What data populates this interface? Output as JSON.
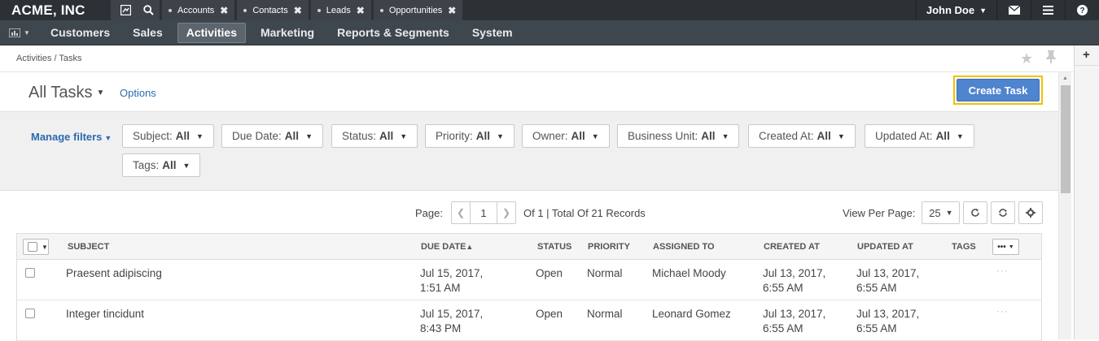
{
  "app": {
    "brand": "ACME, INC"
  },
  "topbar": {
    "quick_tabs": [
      "Accounts",
      "Contacts",
      "Leads",
      "Opportunities"
    ],
    "user_name": "John Doe",
    "icons": [
      "dashboard-icon",
      "search-icon",
      "envelope-icon",
      "menu-icon",
      "help-icon"
    ]
  },
  "nav": {
    "items": [
      "Customers",
      "Sales",
      "Activities",
      "Marketing",
      "Reports & Segments",
      "System"
    ],
    "active": "Activities"
  },
  "breadcrumb": "Activities / Tasks",
  "page": {
    "title": "All Tasks",
    "options_label": "Options",
    "create_button": "Create Task"
  },
  "filters": {
    "manage_label": "Manage filters",
    "chips": [
      {
        "label": "Subject:",
        "value": "All"
      },
      {
        "label": "Due Date:",
        "value": "All"
      },
      {
        "label": "Status:",
        "value": "All"
      },
      {
        "label": "Priority:",
        "value": "All"
      },
      {
        "label": "Owner:",
        "value": "All"
      },
      {
        "label": "Business Unit:",
        "value": "All"
      },
      {
        "label": "Created At:",
        "value": "All"
      },
      {
        "label": "Updated At:",
        "value": "All"
      },
      {
        "label": "Tags:",
        "value": "All"
      }
    ]
  },
  "pager": {
    "page_label": "Page:",
    "page": "1",
    "summary": "Of 1 | Total Of 21 Records",
    "view_per_page_label": "View Per Page:",
    "per_page": "25"
  },
  "grid": {
    "columns": [
      "Subject",
      "Due Date",
      "Status",
      "Priority",
      "Assigned To",
      "Created At",
      "Updated At",
      "Tags"
    ],
    "sort_indicator": "▲",
    "rows": [
      {
        "subject": "Praesent adipiscing",
        "due_date_1": "Jul 15, 2017,",
        "due_date_2": "1:51 AM",
        "status": "Open",
        "priority": "Normal",
        "assigned_to": "Michael Moody",
        "created_1": "Jul 13, 2017,",
        "created_2": "6:55 AM",
        "updated_1": "Jul 13, 2017,",
        "updated_2": "6:55 AM",
        "tags": ""
      },
      {
        "subject": "Integer tincidunt",
        "due_date_1": "Jul 15, 2017,",
        "due_date_2": "8:43 PM",
        "status": "Open",
        "priority": "Normal",
        "assigned_to": "Leonard Gomez",
        "created_1": "Jul 13, 2017,",
        "created_2": "6:55 AM",
        "updated_1": "Jul 13, 2017,",
        "updated_2": "6:55 AM",
        "tags": ""
      }
    ]
  },
  "colors": {
    "topbar": "#2c3136",
    "nav": "#3f474e",
    "link": "#2a6bb0",
    "primary_button": "#4f84cf",
    "highlight_border": "#f2c200"
  }
}
